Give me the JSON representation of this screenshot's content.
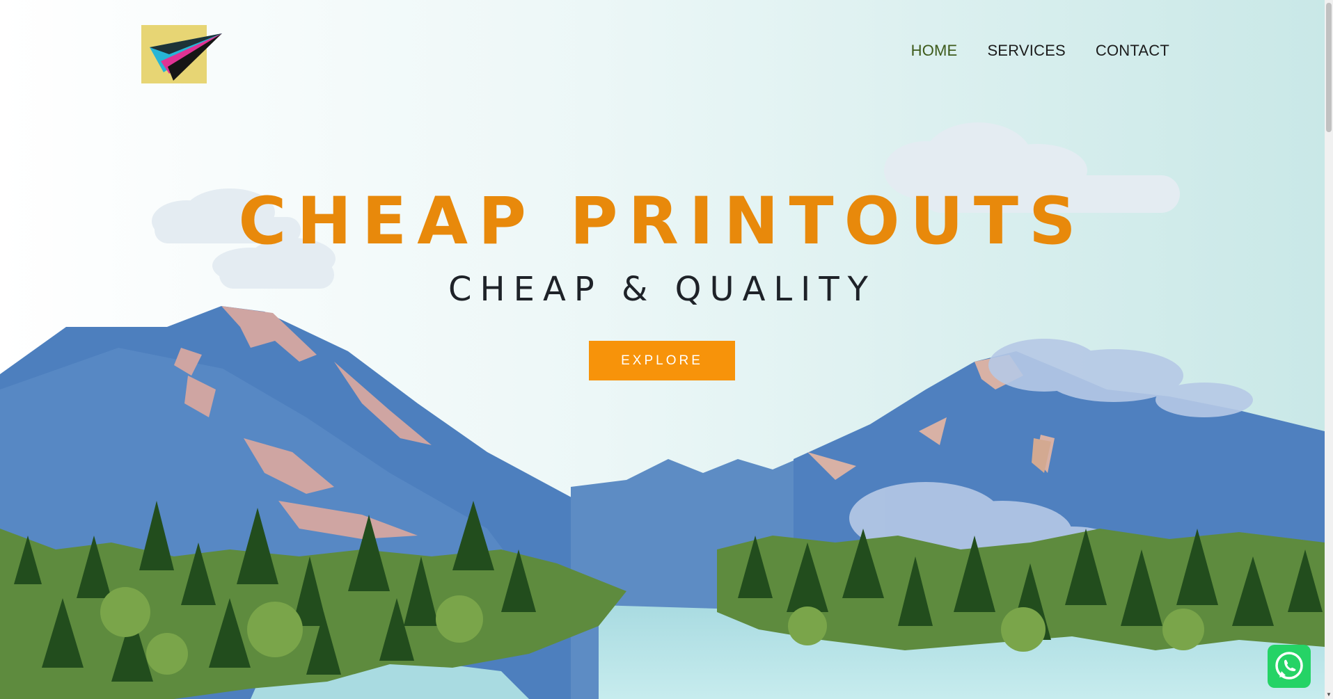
{
  "header": {
    "logo_icon": "paper-plane-logo",
    "nav": [
      {
        "label": "HOME",
        "active": true
      },
      {
        "label": "SERVICES",
        "active": false
      },
      {
        "label": "CONTACT",
        "active": false
      }
    ]
  },
  "hero": {
    "title": "CHEAP PRINTOUTS",
    "subtitle": "CHEAP & QUALITY",
    "cta_label": "EXPLORE",
    "background_icon": "mountain-lake-illustration"
  },
  "floating": {
    "whatsapp_icon": "whatsapp-icon"
  },
  "colors": {
    "title": "#e8890b",
    "cta": "#f7930a",
    "nav_active": "#3d5a1a",
    "nav_text": "#1c1c1c",
    "whatsapp": "#25d366"
  }
}
